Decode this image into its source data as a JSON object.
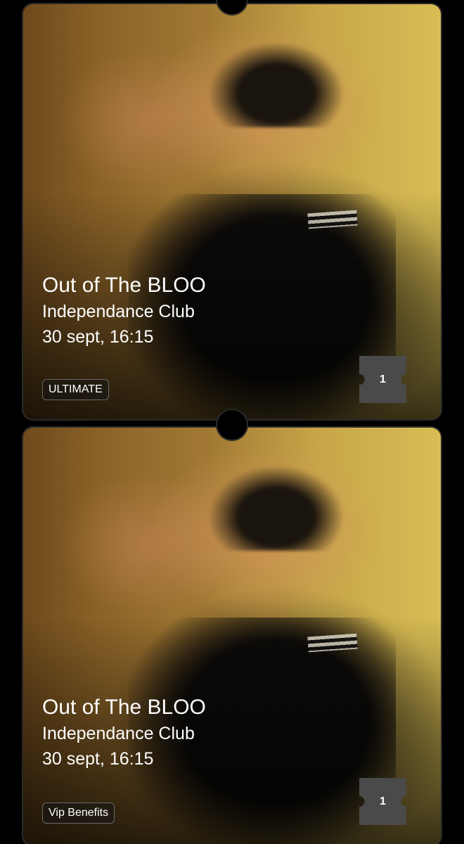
{
  "tickets": [
    {
      "title": "Out of The BLOO",
      "venue": "Independance Club",
      "datetime": "30 sept, 16:15",
      "tier": "ULTIMATE",
      "quantity": "1"
    },
    {
      "title": "Out of The BLOO",
      "venue": "Independance Club",
      "datetime": "30 sept, 16:15",
      "tier": "Vip Benefits",
      "quantity": "1"
    }
  ],
  "colors": {
    "background": "#000000",
    "badge_border": "#6a6a6a",
    "quantity_box": "#4a4a4a",
    "text": "#ffffff"
  },
  "icons": [
    "ticket-stub-icon"
  ]
}
